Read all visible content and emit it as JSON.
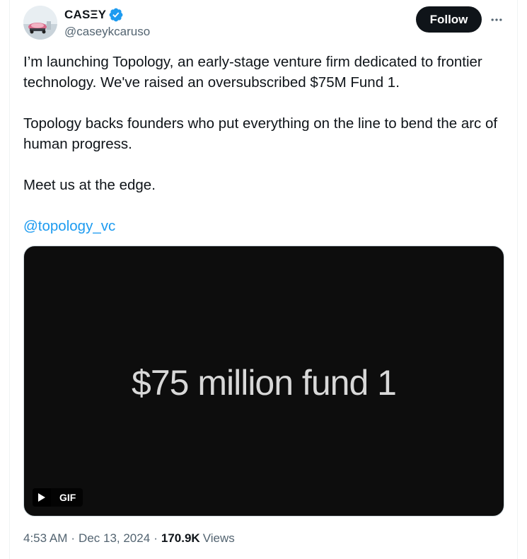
{
  "author": {
    "display_name": "CASΞY",
    "handle": "@caseykcaruso",
    "verified_color": "#1d9bf0"
  },
  "actions": {
    "follow_label": "Follow",
    "more_icon": "more-horizontal-icon"
  },
  "tweet": {
    "paragraph_1": "I’m launching Topology, an early-stage venture firm dedicated to frontier technology. We've raised an oversubscribed $75M Fund 1.",
    "paragraph_2": "Topology backs founders who put everything on the line to bend the arc of human progress.",
    "paragraph_3": "Meet us at the edge.",
    "mention": "@topology_vc"
  },
  "media": {
    "text": "$75 million fund 1",
    "badge_label": "GIF",
    "badge_icon": "play-icon"
  },
  "meta": {
    "time": "4:53 AM",
    "separator": "·",
    "date": "Dec 13, 2024",
    "views_count": "170.9K",
    "views_label": "Views"
  },
  "colors": {
    "accent": "#1d9bf0",
    "text_primary": "#0f1419",
    "text_secondary": "#536471",
    "button_bg": "#0f1419"
  }
}
